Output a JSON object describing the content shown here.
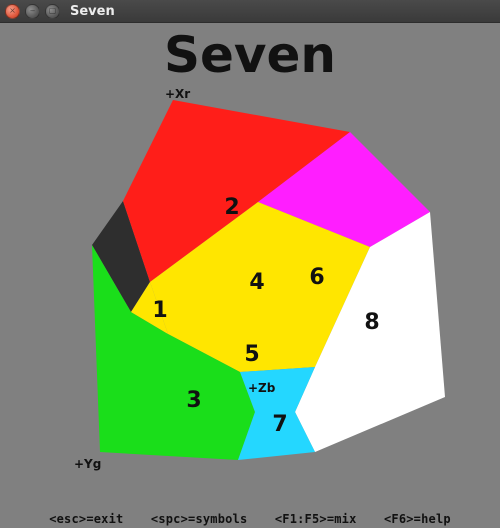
{
  "window": {
    "title": "Seven"
  },
  "heading": "Seven",
  "axes": {
    "xr": "+Xr",
    "yg": "+Yg",
    "zb": "+Zb"
  },
  "venn": {
    "cell1": "1",
    "cell2": "2",
    "cell3": "3",
    "cell4": "4",
    "cell5": "5",
    "cell6": "6",
    "cell7": "7",
    "cell8": "8"
  },
  "help": {
    "exit": "<esc>=exit",
    "symbols": "<spc>=symbols",
    "mix": "<F1:F5>=mix",
    "helpkey": "<F6>=help"
  },
  "colors": {
    "red": "#ff1e19",
    "green": "#1ade1a",
    "blue": "#2bd1ff",
    "yellow": "#ffe600",
    "magenta": "#ff1eff",
    "white": "#ffffff",
    "dark": "#2e2e2e",
    "field": "#808080"
  }
}
